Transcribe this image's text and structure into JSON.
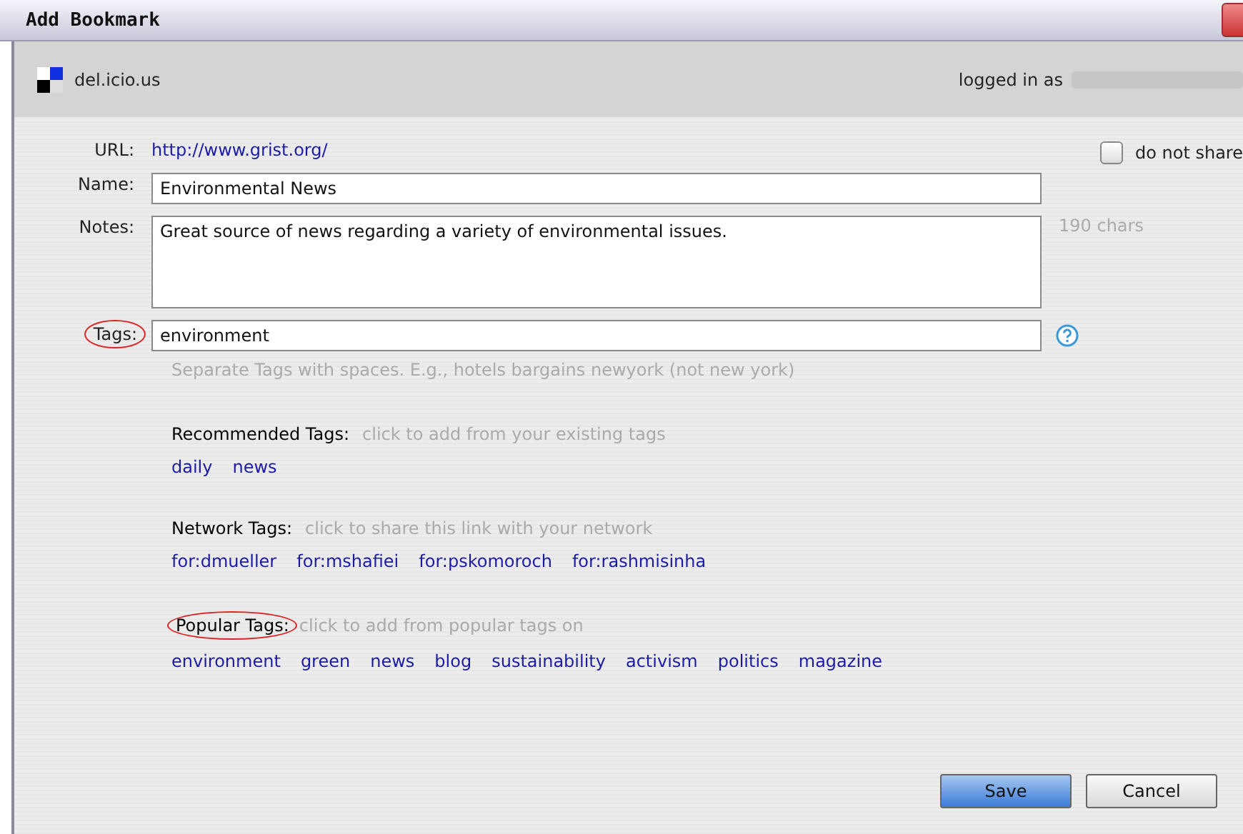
{
  "window": {
    "title": "Add Bookmark"
  },
  "header": {
    "site": "del.icio.us",
    "logged_in_label": "logged in as"
  },
  "url": {
    "label": "URL:",
    "value": "http://www.grist.org/"
  },
  "do_not_share": {
    "label": "do not share",
    "checked": false
  },
  "name": {
    "label": "Name:",
    "value": "Environmental News"
  },
  "notes": {
    "label": "Notes:",
    "value": "Great source of news regarding a variety of environmental issues.",
    "count": "190 chars"
  },
  "tags": {
    "label": "Tags:",
    "circled": true,
    "value": "environment",
    "hint": "Separate Tags with spaces. E.g., hotels bargains newyork (not new york)"
  },
  "tag_groups": [
    {
      "title": "Recommended Tags:",
      "circled": false,
      "hint": "click to add from your existing tags",
      "tags": [
        "daily",
        "news"
      ]
    },
    {
      "title": "Network Tags:",
      "circled": false,
      "hint": "click to share this link with your network",
      "tags": [
        "for:dmueller",
        "for:mshafiei",
        "for:pskomoroch",
        "for:rashmisinha"
      ]
    },
    {
      "title": "Popular Tags:",
      "circled": true,
      "hint": "click to add from popular tags on",
      "tags": [
        "environment",
        "green",
        "news",
        "blog",
        "sustainability",
        "activism",
        "politics",
        "magazine"
      ]
    }
  ],
  "buttons": [
    {
      "label": "Save",
      "kind": "primary"
    },
    {
      "label": "Cancel",
      "kind": "secondary"
    }
  ]
}
